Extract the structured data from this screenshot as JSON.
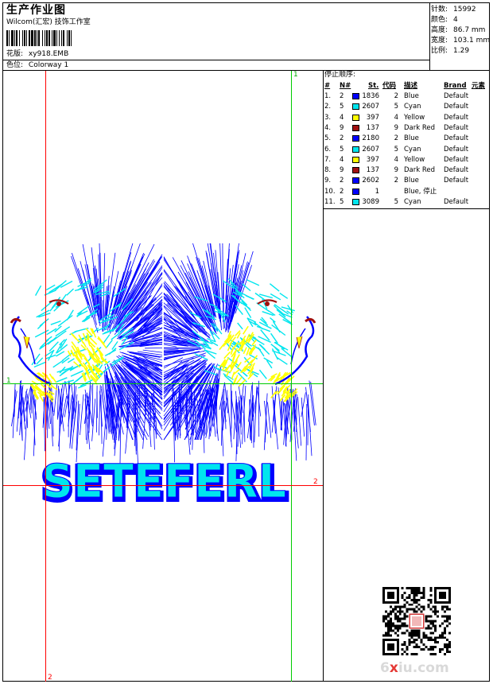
{
  "header": {
    "title": "生产作业图",
    "company": "Wilcom(汇宏) 技饰工作室",
    "design_label": "花版:",
    "design_file": "xy918.EMB",
    "colorway_label": "色位:",
    "colorway": "Colorway 1"
  },
  "stats": [
    {
      "label": "针数:",
      "value": "15992"
    },
    {
      "label": "颜色:",
      "value": "4"
    },
    {
      "label": "高度:",
      "value": "86.7 mm"
    },
    {
      "label": "宽度:",
      "value": "103.1 mm"
    },
    {
      "label": "比例:",
      "value": "1.29"
    }
  ],
  "sequence": {
    "title": "停止顺序:",
    "headers": [
      "#",
      "N#",
      "St.",
      "代码",
      "描述",
      "Brand",
      "元素"
    ],
    "rows": [
      {
        "idx": "1.",
        "n": "2",
        "color": "#0000ff",
        "st": "1836",
        "code": "2",
        "desc": "Blue",
        "brand": "Default"
      },
      {
        "idx": "2.",
        "n": "5",
        "color": "#00e5ee",
        "st": "2607",
        "code": "5",
        "desc": "Cyan",
        "brand": "Default"
      },
      {
        "idx": "3.",
        "n": "4",
        "color": "#ffff00",
        "st": "397",
        "code": "4",
        "desc": "Yellow",
        "brand": "Default"
      },
      {
        "idx": "4.",
        "n": "9",
        "color": "#a01010",
        "st": "137",
        "code": "9",
        "desc": "Dark Red",
        "brand": "Default"
      },
      {
        "idx": "5.",
        "n": "2",
        "color": "#0000ff",
        "st": "2180",
        "code": "2",
        "desc": "Blue",
        "brand": "Default"
      },
      {
        "idx": "6.",
        "n": "5",
        "color": "#00e5ee",
        "st": "2607",
        "code": "5",
        "desc": "Cyan",
        "brand": "Default"
      },
      {
        "idx": "7.",
        "n": "4",
        "color": "#ffff00",
        "st": "397",
        "code": "4",
        "desc": "Yellow",
        "brand": "Default"
      },
      {
        "idx": "8.",
        "n": "9",
        "color": "#a01010",
        "st": "137",
        "code": "9",
        "desc": "Dark Red",
        "brand": "Default"
      },
      {
        "idx": "9.",
        "n": "2",
        "color": "#0000ff",
        "st": "2602",
        "code": "2",
        "desc": "Blue",
        "brand": "Default"
      },
      {
        "idx": "10.",
        "n": "2",
        "color": "#0000ff",
        "st": "1",
        "code": "",
        "desc": "Blue, 停止",
        "brand": ""
      },
      {
        "idx": "11.",
        "n": "5",
        "color": "#00e5ee",
        "st": "3089",
        "code": "5",
        "desc": "Cyan",
        "brand": "Default"
      }
    ]
  },
  "design": {
    "text": "SETEFERL",
    "guide_labels": {
      "top": "1",
      "left": "1",
      "right": "2",
      "bottom": "2"
    },
    "colors": {
      "blue": "#0000ff",
      "cyan": "#00e5ee",
      "yellow": "#ffff00",
      "dark_red": "#a01010",
      "guide_red": "#ff0000",
      "guide_green": "#00cc00"
    }
  },
  "watermark": {
    "pre": "6",
    "mid": "x",
    "post": "iu.com"
  }
}
